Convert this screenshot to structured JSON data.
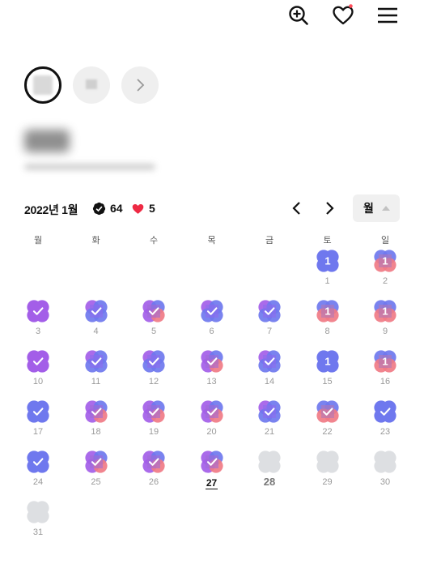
{
  "header": {
    "icons": [
      "search-plus-icon",
      "heart-icon",
      "menu-icon"
    ],
    "heart_dot_color": "#ff4d5a"
  },
  "filters": {
    "chips": [
      "selected-chip",
      "chip",
      "next-arrow"
    ]
  },
  "calendar": {
    "month_label": "2022년 1월",
    "check_count": "64",
    "heart_count": "5",
    "view_mode": "월",
    "weekdays": [
      "월",
      "화",
      "수",
      "목",
      "금",
      "토",
      "일"
    ],
    "colors": {
      "purple": "#a35ee8",
      "blue": "#6f78ee",
      "coral": "#f07b86",
      "empty": "#dddfe2"
    },
    "weeks": [
      [
        null,
        null,
        null,
        null,
        null,
        {
          "day": "1",
          "badge": "1",
          "style": "blue"
        },
        {
          "day": "2",
          "badge": "1",
          "style": "blue-coral"
        }
      ],
      [
        {
          "day": "3",
          "style": "purple-check"
        },
        {
          "day": "4",
          "style": "mix-check"
        },
        {
          "day": "5",
          "style": "tri-check"
        },
        {
          "day": "6",
          "style": "mix-check"
        },
        {
          "day": "7",
          "style": "mix-check"
        },
        {
          "day": "8",
          "badge": "1",
          "style": "blue-coral"
        },
        {
          "day": "9",
          "badge": "1",
          "style": "blue-coral"
        }
      ],
      [
        {
          "day": "10",
          "style": "purple-check"
        },
        {
          "day": "11",
          "style": "mix-check"
        },
        {
          "day": "12",
          "style": "mix-check"
        },
        {
          "day": "13",
          "style": "tri-check"
        },
        {
          "day": "14",
          "style": "mix-check"
        },
        {
          "day": "15",
          "badge": "1",
          "style": "blue"
        },
        {
          "day": "16",
          "badge": "1",
          "style": "blue-coral"
        }
      ],
      [
        {
          "day": "17",
          "style": "blue-check"
        },
        {
          "day": "18",
          "style": "tri-check"
        },
        {
          "day": "19",
          "style": "tri-check"
        },
        {
          "day": "20",
          "style": "tri-check"
        },
        {
          "day": "21",
          "style": "mix-check"
        },
        {
          "day": "22",
          "style": "blue-coral-check"
        },
        {
          "day": "23",
          "style": "blue-check"
        }
      ],
      [
        {
          "day": "24",
          "style": "blue-check"
        },
        {
          "day": "25",
          "style": "tri-check"
        },
        {
          "day": "26",
          "style": "tri-check"
        },
        {
          "day": "27",
          "style": "tri-check",
          "today": true
        },
        {
          "day": "28",
          "style": "empty",
          "bold": true
        },
        {
          "day": "29",
          "style": "empty"
        },
        {
          "day": "30",
          "style": "empty"
        }
      ],
      [
        {
          "day": "31",
          "style": "empty"
        },
        null,
        null,
        null,
        null,
        null,
        null
      ]
    ]
  }
}
